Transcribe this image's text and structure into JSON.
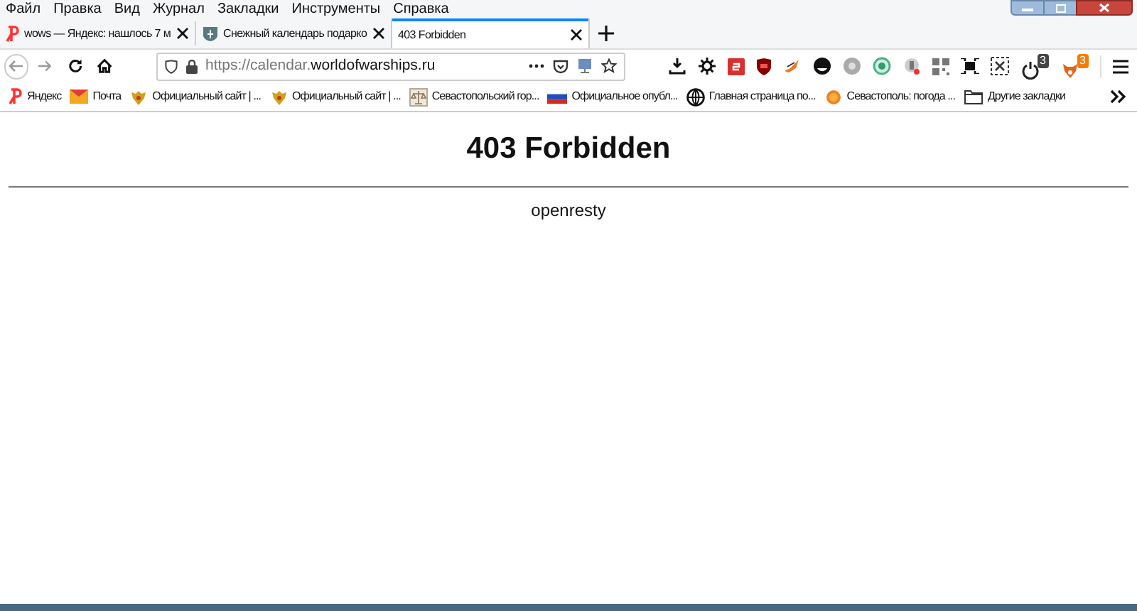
{
  "menu_bar": [
    "Файл",
    "Правка",
    "Вид",
    "Журнал",
    "Закладки",
    "Инструменты",
    "Справка"
  ],
  "tabs": [
    {
      "title": "wows — Яндекс: нашлось 7 м",
      "selected": false,
      "kind": "yandex"
    },
    {
      "title": "Снежный календарь подарко",
      "selected": false,
      "kind": "shield"
    },
    {
      "title": "403 Forbidden",
      "selected": true,
      "kind": "none"
    }
  ],
  "address_bar": {
    "prefix": "https://calendar.",
    "domain": "worldofwarships.ru"
  },
  "extension_badges": [
    {
      "kind": "power",
      "badge": "3"
    },
    {
      "kind": "fox",
      "badge": "3"
    }
  ],
  "bookmarks": [
    {
      "label": "Яндекс",
      "kind": "yandex"
    },
    {
      "label": "Почта",
      "kind": "mail"
    },
    {
      "label": "Официальный сайт | ...",
      "kind": "emblem"
    },
    {
      "label": "Официальный сайт | ...",
      "kind": "emblem"
    },
    {
      "label": "Севастопольский гор...",
      "kind": "scales"
    },
    {
      "label": "Официальное опубл...",
      "kind": "flag"
    },
    {
      "label": "Главная страница по...",
      "kind": "globe"
    },
    {
      "label": "Севастополь: погода ...",
      "kind": "sun"
    },
    {
      "label": "Другие закладки",
      "kind": "folder"
    }
  ],
  "page": {
    "heading": "403 Forbidden",
    "server": "openresty"
  }
}
